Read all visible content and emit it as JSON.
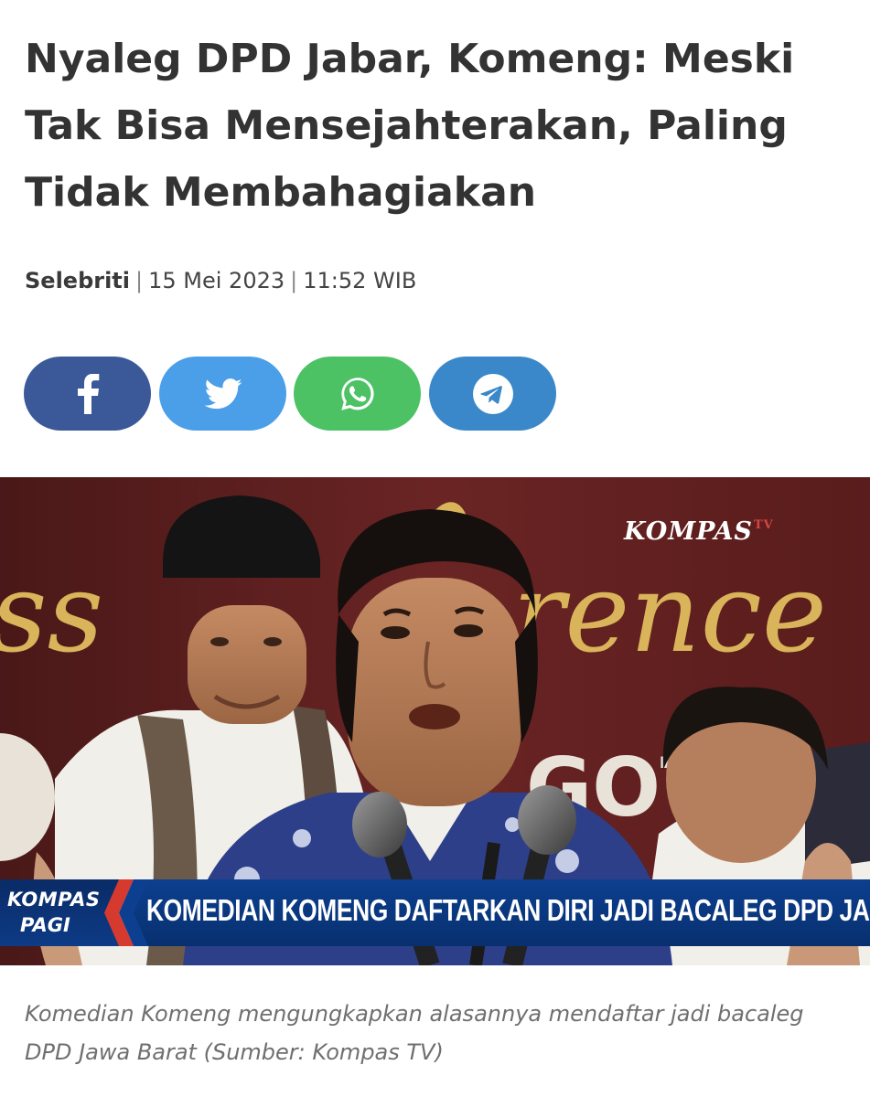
{
  "article": {
    "headline": "Nyaleg DPD Jabar, Komeng: Meski Tak Bisa Mensejahterakan, Paling Tidak Membahagiakan",
    "category": "Selebriti",
    "date": "15 Mei 2023",
    "time": "11:52 WIB",
    "separator": "|"
  },
  "share": [
    {
      "icon": "facebook-icon",
      "color": "#3b5998"
    },
    {
      "icon": "twitter-icon",
      "color": "#4a9fe8"
    },
    {
      "icon": "whatsapp-icon",
      "color": "#4cc265"
    },
    {
      "icon": "telegram-icon",
      "color": "#3a88c9"
    }
  ],
  "photo": {
    "station_logo": "KOMPAS",
    "station_logo_suffix": "TV",
    "backdrop_text_left": "ss",
    "backdrop_text_right": "rence",
    "backdrop_text_lower": "GOT",
    "ticker": {
      "show_line1": "KOMPAS",
      "show_line2": "PAGI",
      "headline": "KOMEDIAN KOMENG DAFTARKAN DIRI JADI BACALEG DPD JABAR"
    }
  },
  "caption": "Komedian Komeng mengungkapkan alasannya mendaftar jadi bacaleg DPD Jawa Barat (Sumber: Kompas TV)",
  "colors": {
    "headline": "#333333",
    "caption": "#6f6f6f",
    "ticker_blue": "#0c3f8f",
    "backdrop_maroon": "#5a1f1f",
    "backdrop_gold": "#d9b45a"
  }
}
